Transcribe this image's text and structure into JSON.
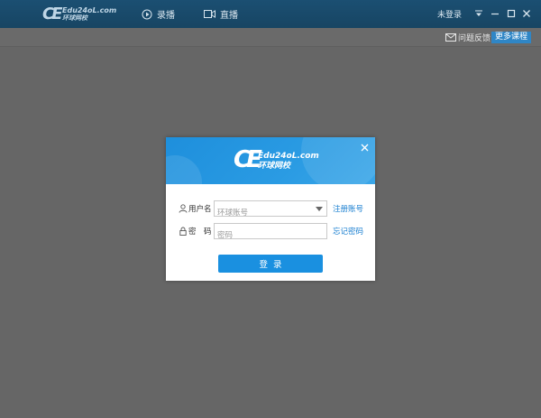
{
  "app": {
    "logo_mark": "CE",
    "logo_text": "Edu24oL.com",
    "logo_sub": "环球网校"
  },
  "nav": {
    "record_label": "录播",
    "live_label": "直播"
  },
  "window": {
    "login_status": "未登录"
  },
  "toolbar": {
    "feedback_label": "问题反馈",
    "more_courses_label": "更多课程"
  },
  "dialog": {
    "logo_mark": "CE",
    "logo_text": "Edu24oL.com",
    "logo_sub": "环球网校",
    "username_label": "用户名",
    "username_placeholder": "环球账号",
    "username_value": "",
    "password_label": "密　码",
    "password_placeholder": "密码",
    "password_value": "",
    "register_link": "注册账号",
    "forgot_link": "忘记密码",
    "login_button": "登录"
  },
  "colors": {
    "titlebar": "#174563",
    "background": "#666666",
    "accent": "#1a90e0",
    "link": "#1a7fd0"
  },
  "icons": [
    "play-circle-icon",
    "video-camera-icon",
    "menu-down-icon",
    "minimize-icon",
    "maximize-icon",
    "close-icon",
    "mail-icon",
    "user-icon",
    "lock-icon",
    "dropdown-arrow-icon"
  ]
}
